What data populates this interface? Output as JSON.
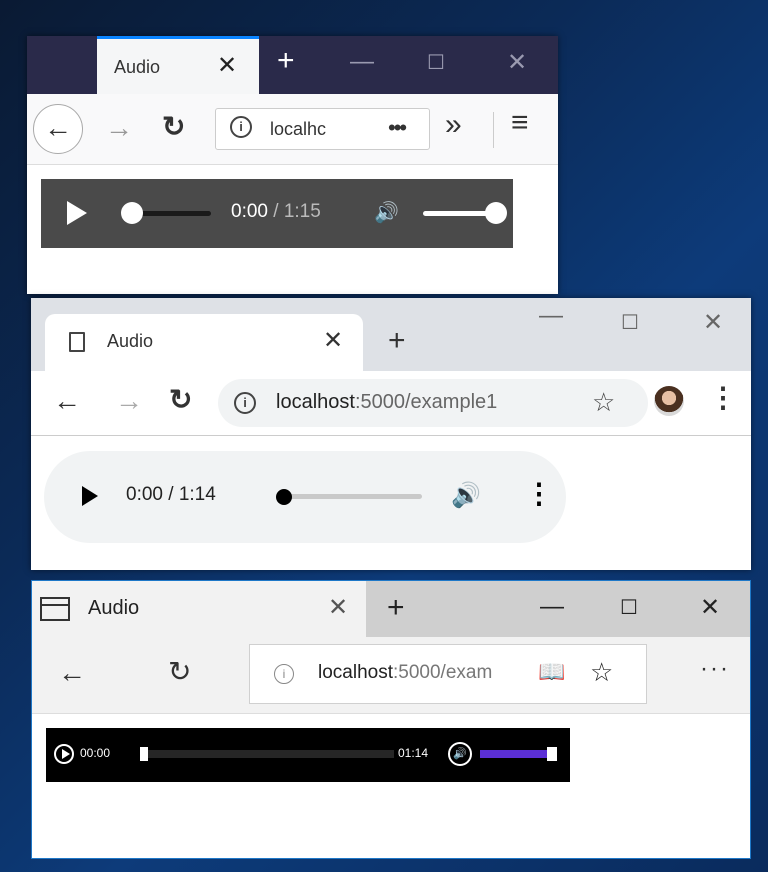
{
  "firefox": {
    "tab_label": "Audio",
    "tab_close": "✕",
    "new_tab": "+",
    "minimize": "—",
    "maximize": "☐",
    "close": "✕",
    "back": "←",
    "forward": "→",
    "reload": "↻",
    "url_info": "i",
    "url_text": "localhc",
    "url_more": "•••",
    "overflow": "»",
    "menu": "≡",
    "audio": {
      "current": "0:00",
      "duration": "1:15",
      "separator": " / ",
      "volume_icon": "🔊",
      "progress": 0.0,
      "volume": 1.0
    }
  },
  "chrome": {
    "tab_label": "Audio",
    "tab_close": "✕",
    "new_tab": "+",
    "minimize": "—",
    "maximize": "☐",
    "close": "✕",
    "back": "←",
    "forward": "→",
    "reload": "↻",
    "url_info": "i",
    "url_host": "localhost",
    "url_path": ":5000/example1",
    "star": "☆",
    "menu": "⋮",
    "audio": {
      "time": "0:00 / 1:14",
      "volume_icon": "🔊",
      "more": "⋮",
      "progress": 0.0
    }
  },
  "edge": {
    "tab_label": "Audio",
    "tab_close": "✕",
    "new_tab": "+",
    "minimize": "—",
    "maximize": "☐",
    "close": "✕",
    "back": "←",
    "reload": "↻",
    "url_info": "i",
    "url_host": "localhost",
    "url_path": ":5000/exam",
    "reading_view": "📖",
    "star": "☆",
    "more": "···",
    "audio": {
      "current": "00:00",
      "duration": "01:14",
      "volume_icon": "🔊",
      "progress": 0.0,
      "volume": 1.0
    }
  }
}
